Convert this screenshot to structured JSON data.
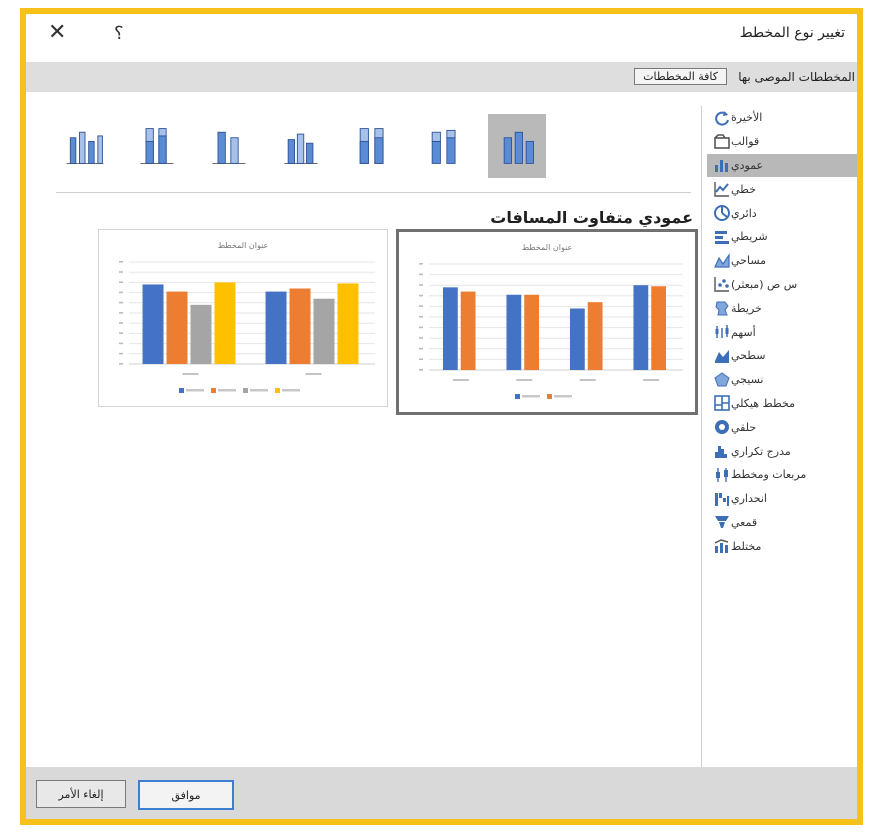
{
  "dialog": {
    "title": "تغيير نوع المخطط",
    "close_glyph": "✕",
    "help_glyph": "؟"
  },
  "tabs": {
    "recommended": "المخططات الموصى بها",
    "all": "كافة المخططات"
  },
  "sidebar": {
    "items": [
      {
        "label": "الأخيرة",
        "icon": "recent-icon"
      },
      {
        "label": "قوالب",
        "icon": "templates-icon"
      },
      {
        "label": "عمودي",
        "icon": "column-chart-icon",
        "selected": true
      },
      {
        "label": "خطي",
        "icon": "line-chart-icon"
      },
      {
        "label": "دائري",
        "icon": "pie-chart-icon"
      },
      {
        "label": "شريطي",
        "icon": "bar-chart-icon"
      },
      {
        "label": "مساحي",
        "icon": "area-chart-icon"
      },
      {
        "label": "س ص (مبعثر)",
        "icon": "scatter-chart-icon"
      },
      {
        "label": "خريطة",
        "icon": "map-chart-icon"
      },
      {
        "label": "أسهم",
        "icon": "stock-chart-icon"
      },
      {
        "label": "سطحي",
        "icon": "surface-chart-icon"
      },
      {
        "label": "نسيجي",
        "icon": "radar-chart-icon"
      },
      {
        "label": "مخطط هيكلي",
        "icon": "treemap-chart-icon"
      },
      {
        "label": "حلقي",
        "icon": "sunburst-chart-icon"
      },
      {
        "label": "مدرج تكراري",
        "icon": "histogram-chart-icon"
      },
      {
        "label": "مربعات ومخطط",
        "icon": "box-whisker-chart-icon"
      },
      {
        "label": "انحداري",
        "icon": "waterfall-chart-icon"
      },
      {
        "label": "قمعي",
        "icon": "funnel-chart-icon"
      },
      {
        "label": "مختلط",
        "icon": "combo-chart-icon"
      }
    ]
  },
  "subtypes": [
    {
      "name": "clustered-column",
      "selected": true
    },
    {
      "name": "stacked-column"
    },
    {
      "name": "100-stacked-column"
    },
    {
      "name": "3d-clustered-column"
    },
    {
      "name": "3d-stacked-column"
    },
    {
      "name": "3d-100-stacked-column"
    },
    {
      "name": "3d-column"
    }
  ],
  "section_heading": "عمودي متفاوت المسافات",
  "colors": {
    "blue": "#4472c4",
    "orange": "#ed7d31",
    "gray": "#a5a5a5",
    "gold": "#ffc000",
    "frame": "#f6c21a"
  },
  "chart_data": [
    {
      "type": "bar",
      "title": "عنوان المخطط",
      "categories": [
        "",
        "",
        "",
        ""
      ],
      "series": [
        {
          "name": "",
          "color": "#4472c4",
          "values": [
            78,
            71,
            58,
            80
          ]
        },
        {
          "name": "",
          "color": "#ed7d31",
          "values": [
            74,
            71,
            64,
            79
          ]
        }
      ],
      "ylim": [
        0,
        100
      ],
      "grid": true,
      "legend": "bottom"
    },
    {
      "type": "bar",
      "title": "عنوان المخطط",
      "categories": [
        "",
        ""
      ],
      "series": [
        {
          "name": "",
          "color": "#4472c4",
          "values": [
            78,
            71
          ]
        },
        {
          "name": "",
          "color": "#ed7d31",
          "values": [
            71,
            74
          ]
        },
        {
          "name": "",
          "color": "#a5a5a5",
          "values": [
            58,
            64
          ]
        },
        {
          "name": "",
          "color": "#ffc000",
          "values": [
            80,
            79
          ]
        }
      ],
      "ylim": [
        0,
        100
      ],
      "grid": true,
      "legend": "bottom"
    }
  ],
  "footer": {
    "ok": "موافق",
    "cancel": "إلغاء الأمر"
  }
}
